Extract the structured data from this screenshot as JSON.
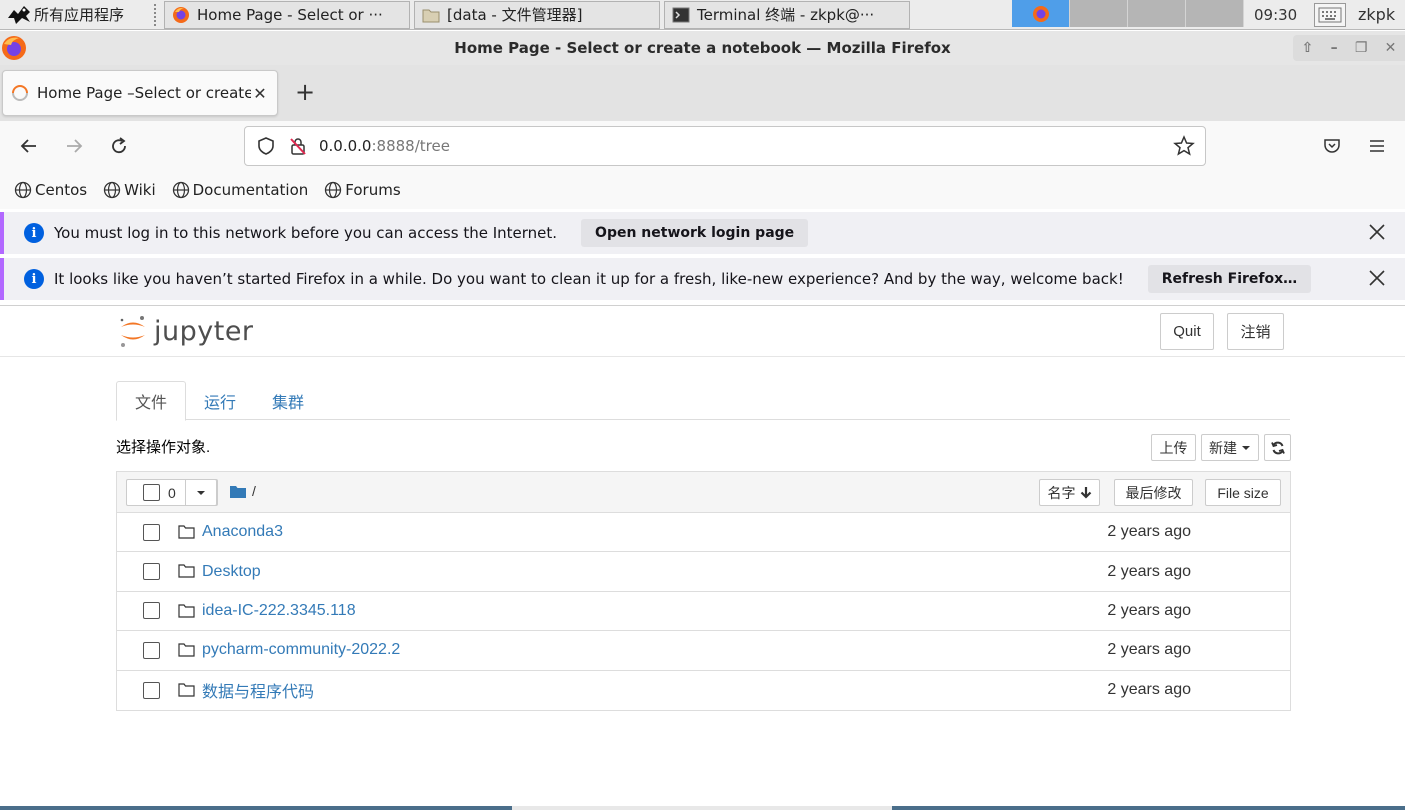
{
  "taskbar": {
    "apps_menu": "所有应用程序",
    "tasks": [
      {
        "label": "Home Page - Select or ···"
      },
      {
        "label": "[data - 文件管理器]"
      },
      {
        "label": "Terminal 终端 - zkpk@···"
      }
    ],
    "clock": "09:30",
    "user": "zkpk"
  },
  "window": {
    "title": "Home Page - Select or create a notebook — Mozilla Firefox"
  },
  "browser": {
    "tab_title": "Home Page –Select or create a notebook",
    "url_host": "0.0.0.0",
    "url_rest": ":8888/tree",
    "bookmarks": [
      {
        "label": "Centos"
      },
      {
        "label": "Wiki"
      },
      {
        "label": "Documentation"
      },
      {
        "label": "Forums"
      }
    ],
    "notices": [
      {
        "text": "You must log in to this network before you can access the Internet.",
        "button": "Open network login page"
      },
      {
        "text": "It looks like you haven’t started Firefox in a while. Do you want to clean it up for a fresh, like-new experience? And by the way, welcome back!",
        "button": "Refresh Firefox…"
      }
    ]
  },
  "jupyter": {
    "brand": "jupyter",
    "quit_label": "Quit",
    "logout_label": "注销",
    "tabs": [
      {
        "label": "文件"
      },
      {
        "label": "运行"
      },
      {
        "label": "集群"
      }
    ],
    "toolbar_text": "选择操作对象.",
    "upload_label": "上传",
    "new_label": "新建",
    "selected_count": "0",
    "breadcrumb": "/",
    "sort": {
      "name": "名字",
      "modified": "最后修改",
      "size": "File size"
    },
    "items": [
      {
        "name": "Anaconda3",
        "modified": "2 years ago"
      },
      {
        "name": "Desktop",
        "modified": "2 years ago"
      },
      {
        "name": "idea-IC-222.3345.118",
        "modified": "2 years ago"
      },
      {
        "name": "pycharm-community-2022.2",
        "modified": "2 years ago"
      },
      {
        "name": "数据与程序代码",
        "modified": "2 years ago"
      }
    ]
  },
  "colors": {
    "link": "#337ab7",
    "firefox_orange": "#f56a19",
    "info_blue": "#0060df",
    "notice_accent": "#b268ff"
  }
}
